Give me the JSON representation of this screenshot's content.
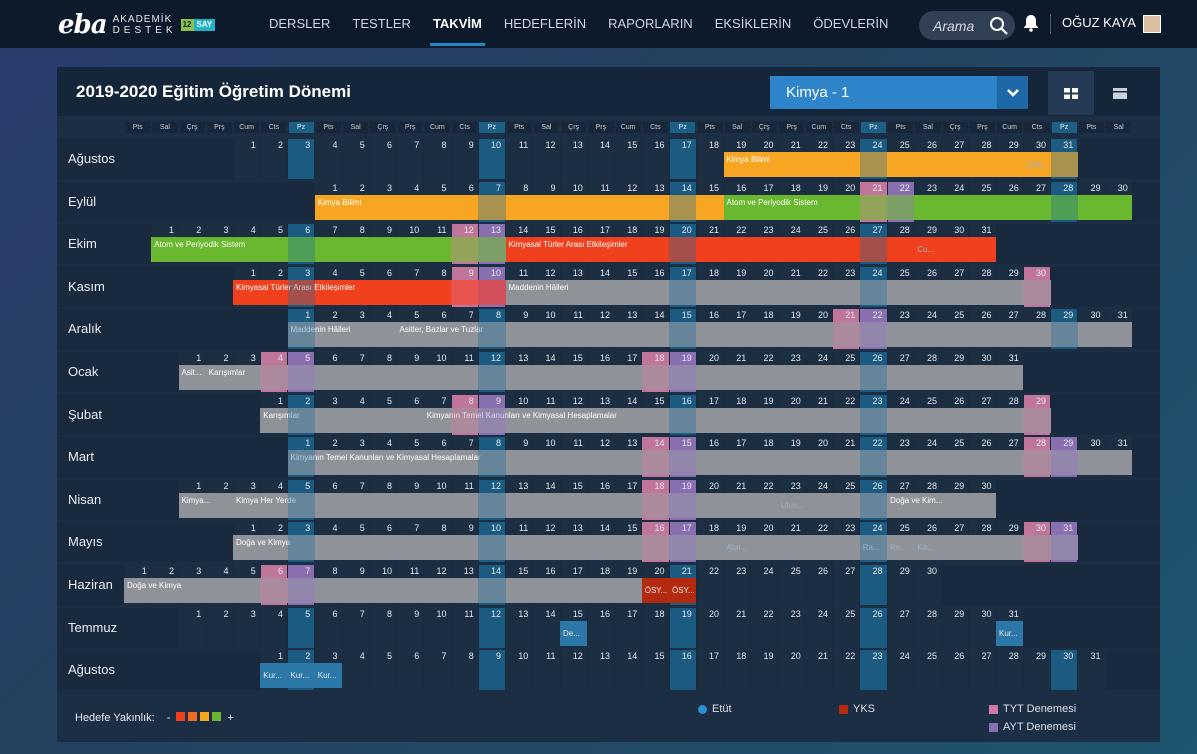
{
  "topbar": {
    "logo_word": "eba",
    "logo_line1": "AKADEMİK",
    "logo_line2": "DESTEK",
    "badge_grade": "12",
    "badge_track": "SAY",
    "search_placeholder": "Arama",
    "user_name": "OĞUZ KAYA"
  },
  "nav": [
    "DERSLER",
    "TESTLER",
    "TAKVİM",
    "HEDEFLERİN",
    "RAPORLARIN",
    "EKSİKLERİN",
    "ÖDEVLERİN"
  ],
  "nav_active": 2,
  "panel": {
    "title": "2019-2020 Eğitim Öğretim Dönemi",
    "course_selected": "Kimya - 1",
    "view_grid": "grid-view-icon",
    "view_list": "list-view-icon"
  },
  "weekdays": [
    "Pts",
    "Sal",
    "Çrş",
    "Prş",
    "Cum",
    "Cts",
    "Pz"
  ],
  "months": [
    {
      "name": "Ağustos",
      "start": 4,
      "days": 31,
      "tyt": [],
      "ayt": []
    },
    {
      "name": "Eylül",
      "start": 7,
      "days": 30,
      "tyt": [
        21
      ],
      "ayt": [
        22
      ]
    },
    {
      "name": "Ekim",
      "start": 1,
      "days": 31,
      "tyt": [
        12
      ],
      "ayt": [
        13
      ]
    },
    {
      "name": "Kasım",
      "start": 4,
      "days": 30,
      "tyt": [
        9,
        30
      ],
      "ayt": [
        10
      ]
    },
    {
      "name": "Aralık",
      "start": 6,
      "days": 31,
      "tyt": [
        21
      ],
      "ayt": [
        22
      ]
    },
    {
      "name": "Ocak",
      "start": 2,
      "days": 31,
      "tyt": [
        4,
        18
      ],
      "ayt": [
        5,
        19
      ]
    },
    {
      "name": "Şubat",
      "start": 5,
      "days": 29,
      "tyt": [
        8,
        29
      ],
      "ayt": [
        9
      ]
    },
    {
      "name": "Mart",
      "start": 6,
      "days": 31,
      "tyt": [
        14,
        28
      ],
      "ayt": [
        15,
        29
      ]
    },
    {
      "name": "Nisan",
      "start": 2,
      "days": 30,
      "tyt": [
        18
      ],
      "ayt": [
        19
      ]
    },
    {
      "name": "Mayıs",
      "start": 4,
      "days": 31,
      "tyt": [
        16,
        30
      ],
      "ayt": [
        17,
        31
      ]
    },
    {
      "name": "Haziran",
      "start": 0,
      "days": 30,
      "tyt": [
        6
      ],
      "ayt": [
        7
      ]
    },
    {
      "name": "Temmuz",
      "start": 2,
      "days": 31,
      "tyt": [],
      "ayt": []
    },
    {
      "name": "Ağustos",
      "start": 5,
      "days": 31,
      "tyt": [],
      "ayt": []
    }
  ],
  "bars": [
    {
      "row": 0,
      "from": 19,
      "to": 31,
      "color": "orange",
      "label": "Kimya Bilimi"
    },
    {
      "row": 1,
      "from": 1,
      "to": 15,
      "color": "orange",
      "label": "Kimya Bilimi"
    },
    {
      "row": 1,
      "from": 16,
      "to": 30,
      "color": "green",
      "label": "Atom ve Periyodik Sistem"
    },
    {
      "row": 2,
      "from": 1,
      "to": 13,
      "color": "green",
      "label": "Atom ve Periyodik Sistem"
    },
    {
      "row": 2,
      "from": 14,
      "to": 31,
      "color": "red",
      "label": "Kimyasal Türler Arası Etkileşimler"
    },
    {
      "row": 3,
      "from": 1,
      "to": 10,
      "color": "red",
      "label": "Kimyasal Türler Arası Etkileşimler"
    },
    {
      "row": 3,
      "from": 11,
      "to": 30,
      "color": "gray",
      "label": "Maddenin Hâlleri"
    },
    {
      "row": 4,
      "from": 1,
      "to": 4,
      "color": "gray",
      "label": "Maddenin Hâlleri"
    },
    {
      "row": 4,
      "from": 5,
      "to": 31,
      "color": "gray",
      "label": "Asitler, Bazlar ve Tuzlar"
    },
    {
      "row": 5,
      "from": 1,
      "to": 1,
      "color": "gray",
      "label": "Asit..."
    },
    {
      "row": 5,
      "from": 2,
      "to": 31,
      "color": "gray",
      "label": "Karışımlar"
    },
    {
      "row": 6,
      "from": 1,
      "to": 6,
      "color": "gray",
      "label": "Karışımlar"
    },
    {
      "row": 6,
      "from": 7,
      "to": 29,
      "color": "gray",
      "label": "Kimyanın Temel Kanunları ve Kimyasal Hesaplamalar"
    },
    {
      "row": 7,
      "from": 1,
      "to": 31,
      "color": "gray",
      "label": "Kimyanın Temel Kanunları ve Kimyasal Hesaplamalar"
    },
    {
      "row": 8,
      "from": 1,
      "to": 2,
      "color": "gray",
      "label": "Kimya..."
    },
    {
      "row": 8,
      "from": 3,
      "to": 26,
      "color": "gray",
      "label": "Kimya Her Yerde"
    },
    {
      "row": 8,
      "from": 27,
      "to": 30,
      "color": "gray",
      "label": "Doğa ve Kim..."
    },
    {
      "row": 9,
      "from": 1,
      "to": 31,
      "color": "gray",
      "label": "Doğa ve Kimya"
    },
    {
      "row": 10,
      "from": 1,
      "to": 19,
      "color": "gray",
      "label": "Doğa ve Kimya"
    }
  ],
  "events": [
    {
      "row": 0,
      "from": 30,
      "to": 31,
      "type": "dim",
      "label": "Zafe..."
    },
    {
      "row": 2,
      "from": 29,
      "to": 29,
      "type": "dim",
      "label": "Cu..."
    },
    {
      "row": 8,
      "from": 23,
      "to": 23,
      "type": "dim",
      "label": "Ulus..."
    },
    {
      "row": 9,
      "from": 19,
      "to": 19,
      "type": "dim",
      "label": "Atat..."
    },
    {
      "row": 9,
      "from": 24,
      "to": 24,
      "type": "dim",
      "label": "Ra..."
    },
    {
      "row": 9,
      "from": 25,
      "to": 25,
      "type": "dim",
      "label": "Ra..."
    },
    {
      "row": 9,
      "from": 26,
      "to": 26,
      "type": "dim",
      "label": "Ka..."
    },
    {
      "row": 10,
      "from": 20,
      "to": 20,
      "type": "yks",
      "label": "ÖSY..."
    },
    {
      "row": 10,
      "from": 21,
      "to": 21,
      "type": "yks",
      "label": "ÖSY..."
    },
    {
      "row": 11,
      "from": 15,
      "to": 15,
      "type": "etut",
      "label": "De..."
    },
    {
      "row": 11,
      "from": 31,
      "to": 31,
      "type": "etut",
      "label": "Kur..."
    },
    {
      "row": 12,
      "from": 1,
      "to": 1,
      "type": "etut",
      "label": "Kur..."
    },
    {
      "row": 12,
      "from": 2,
      "to": 2,
      "type": "etut",
      "label": "Kur..."
    },
    {
      "row": 12,
      "from": 3,
      "to": 3,
      "type": "etut",
      "label": "Kur..."
    }
  ],
  "legend": {
    "proximity_label": "Hedefe Yakınlık:",
    "minus": "-",
    "plus": "+",
    "proximity_colors": [
      "#f0401e",
      "#f26a1f",
      "#f6a623",
      "#6ab82f"
    ],
    "etut": "Etüt",
    "yks": "YKS",
    "tyt": "TYT Denemesi",
    "ayt": "AYT Denemesi",
    "etut_color": "#2a8fd3",
    "yks_color": "#b42a0e",
    "tyt_color": "#d07aa8",
    "ayt_color": "#8a6fb0"
  }
}
